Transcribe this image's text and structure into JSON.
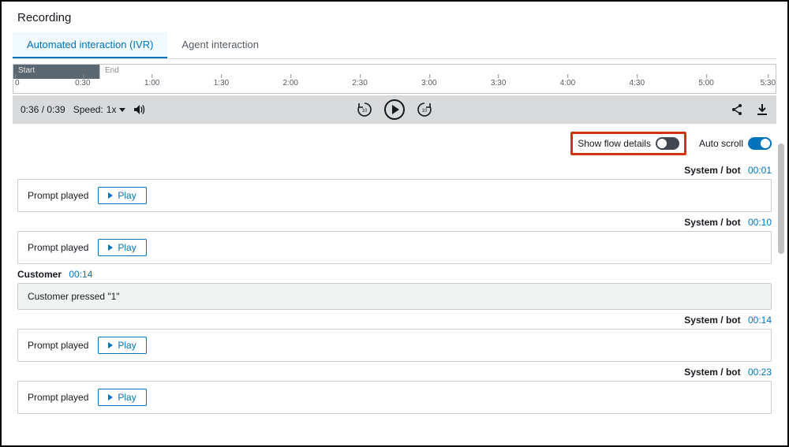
{
  "section_title": "Recording",
  "tabs": {
    "ivr": "Automated interaction (IVR)",
    "agent": "Agent interaction"
  },
  "timeline": {
    "start_label": "Start",
    "end_label": "End",
    "ticks": [
      "0",
      "0:30",
      "1:00",
      "1:30",
      "2:00",
      "2:30",
      "3:00",
      "3:30",
      "4:00",
      "4:30",
      "5:00",
      "5:30"
    ]
  },
  "player": {
    "time_display": "0:36 / 0:39",
    "speed_label": "Speed:",
    "speed_value": "1x",
    "skip_back_amount": "10",
    "skip_fwd_amount": "10"
  },
  "toggles": {
    "flow_label": "Show flow details",
    "flow_on": false,
    "autoscroll_label": "Auto scroll",
    "autoscroll_on": true
  },
  "transcript": [
    {
      "side": "right",
      "who": "System / bot",
      "ts": "00:01",
      "kind": "prompt",
      "label": "Prompt played",
      "play": "Play"
    },
    {
      "side": "right",
      "who": "System / bot",
      "ts": "00:10",
      "kind": "prompt",
      "label": "Prompt played",
      "play": "Play"
    },
    {
      "side": "left",
      "who": "Customer",
      "ts": "00:14",
      "kind": "input",
      "label": "Customer pressed \"1\""
    },
    {
      "side": "right",
      "who": "System / bot",
      "ts": "00:14",
      "kind": "prompt",
      "label": "Prompt played",
      "play": "Play"
    },
    {
      "side": "right",
      "who": "System / bot",
      "ts": "00:23",
      "kind": "prompt",
      "label": "Prompt played",
      "play": "Play"
    }
  ]
}
